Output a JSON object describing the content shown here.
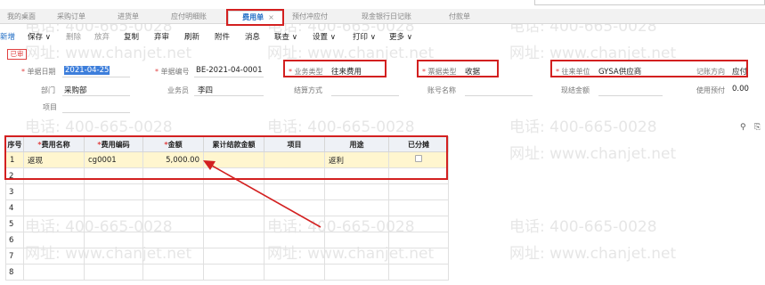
{
  "tabs": [
    {
      "label": "我的桌面"
    },
    {
      "label": "采购订单"
    },
    {
      "label": "进货单"
    },
    {
      "label": "应付明细账"
    },
    {
      "label": "费用单",
      "active": true
    },
    {
      "label": "预付冲应付"
    },
    {
      "label": "现金银行日记账"
    },
    {
      "label": "付款单"
    }
  ],
  "tab_close": "×",
  "toolbar": {
    "new": "新增",
    "save": "保存",
    "delete": "删除",
    "discard": "放弃",
    "copy": "复制",
    "unapprove": "弃审",
    "refresh": "刷新",
    "attachment": "附件",
    "message": "消息",
    "linked_query": "联查",
    "settings": "设置",
    "print": "打印",
    "more": "更多"
  },
  "status_badge": "已审",
  "form": {
    "doc_date": {
      "label": "单据日期",
      "value": "2021-04-25",
      "required": true
    },
    "doc_no": {
      "label": "单据编号",
      "value": "BE-2021-04-0001",
      "required": true
    },
    "biz_type": {
      "label": "业务类型",
      "value": "往来费用",
      "required": true
    },
    "receipt_type": {
      "label": "票据类型",
      "value": "收据",
      "required": true
    },
    "partner": {
      "label": "往来单位",
      "value": "GYSA供应商",
      "required": true
    },
    "direction": {
      "label": "记账方向",
      "value": "应付"
    },
    "department": {
      "label": "部门",
      "value": "采购部"
    },
    "salesperson": {
      "label": "业务员",
      "value": "李四"
    },
    "settle_method": {
      "label": "结算方式",
      "value": ""
    },
    "account_name": {
      "label": "账号名称",
      "value": ""
    },
    "cash_amount": {
      "label": "现结金额",
      "value": ""
    },
    "use_prepaid": {
      "label": "使用预付",
      "value": "0.00"
    },
    "project": {
      "label": "项目",
      "value": ""
    }
  },
  "right_icons": [
    "location-icon",
    "export-icon"
  ],
  "grid": {
    "columns": [
      "序号",
      "费用名称",
      "费用编码",
      "金额",
      "累计结款金额",
      "项目",
      "用途",
      "已分摊"
    ],
    "required_cols": [
      false,
      true,
      true,
      true,
      false,
      false,
      false,
      false
    ],
    "rows": [
      {
        "no": "1",
        "name": "返现",
        "code": "cg0001",
        "amount": "5,000.00",
        "settled": "",
        "project": "",
        "purpose": "返利",
        "allocated": false
      }
    ],
    "empty_row_numbers": [
      "2",
      "3",
      "4",
      "5",
      "6",
      "7",
      "8"
    ]
  },
  "watermark": {
    "phone": "电话: 400-665-0028",
    "site": "网址: www.chanjet.net"
  },
  "colors": {
    "highlight_red": "#d32020",
    "accent_blue": "#1f6cc4",
    "selected_row": "#fff6cf"
  }
}
